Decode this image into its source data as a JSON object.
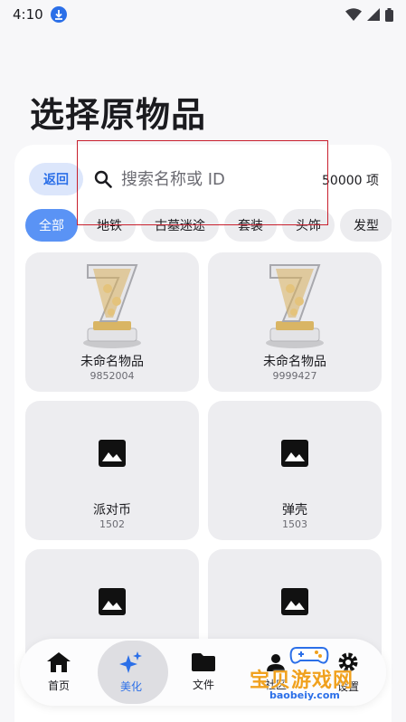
{
  "status_bar": {
    "time": "4:10"
  },
  "title": "选择原物品",
  "toolbar": {
    "back_label": "返回",
    "search_placeholder": "搜索名称或 ID",
    "count_label": "50000 项"
  },
  "categories": [
    "全部",
    "地铁",
    "古墓迷途",
    "套装",
    "头饰",
    "发型"
  ],
  "items": [
    {
      "name": "未命名物品",
      "id": "9852004",
      "icon": "trophy-7-image"
    },
    {
      "name": "未命名物品",
      "id": "9999427",
      "icon": "trophy-7-image"
    },
    {
      "name": "派对币",
      "id": "1502",
      "icon": "image-placeholder-icon"
    },
    {
      "name": "弹壳",
      "id": "1503",
      "icon": "image-placeholder-icon"
    },
    {
      "name": "",
      "id": "",
      "icon": "image-placeholder-icon"
    },
    {
      "name": "",
      "id": "",
      "icon": "image-placeholder-icon"
    }
  ],
  "bottom_nav": [
    {
      "label": "首页",
      "icon": "home-icon"
    },
    {
      "label": "美化",
      "icon": "sparkle-icon",
      "active": true
    },
    {
      "label": "文件",
      "icon": "folder-icon"
    },
    {
      "label": "社区",
      "icon": "community-icon"
    },
    {
      "label": "设置",
      "icon": "settings-icon"
    }
  ],
  "watermark": {
    "text": "宝贝游戏网",
    "url": "baobeiy.com"
  },
  "colors": {
    "accent": "#2b6fe8",
    "chip_active": "#5a93f5",
    "selection_box": "#c8202e"
  }
}
